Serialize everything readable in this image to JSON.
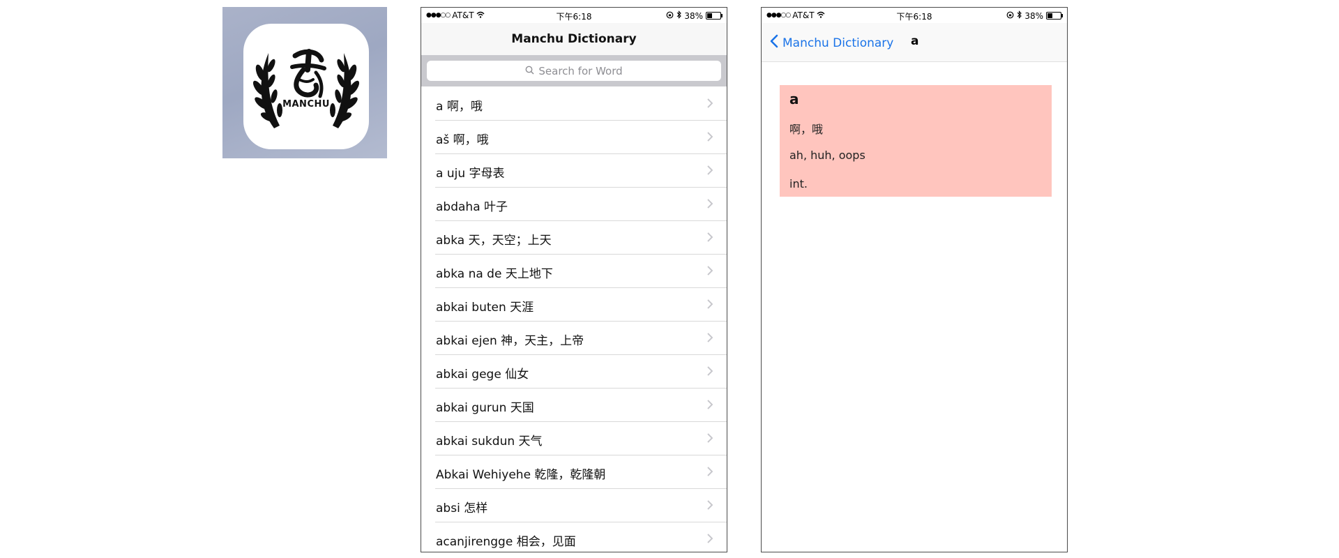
{
  "status": {
    "carrier": "AT&T",
    "time": "下午6:18",
    "battery": "38%",
    "battery_level": 0.38
  },
  "list_screen": {
    "title": "Manchu Dictionary",
    "search_placeholder": "Search for Word",
    "entries": [
      "a  啊，哦",
      "aš  啊，哦",
      "a uju  字母表",
      "abdaha  叶子",
      "abka  天，天空；上天",
      "abka na de  天上地下",
      "abkai buten  天涯",
      "abkai ejen  神，天主，上帝",
      "abkai gege  仙女",
      "abkai gurun  天国",
      "abkai sukdun  天气",
      "Abkai Wehiyehe  乾隆，乾隆朝",
      "absi  怎样",
      "acanjirengge  相会，见面"
    ]
  },
  "detail_screen": {
    "back_label": "Manchu Dictionary",
    "title": "a",
    "word": "a",
    "chinese": "啊，哦",
    "english": "ah, huh, oops",
    "part_of_speech": "int.",
    "card_color": "#ffc5be"
  },
  "app_icon": {
    "label": "MANCHU"
  },
  "colors": {
    "accent": "#1a73e8",
    "card": "#ffc5be"
  }
}
